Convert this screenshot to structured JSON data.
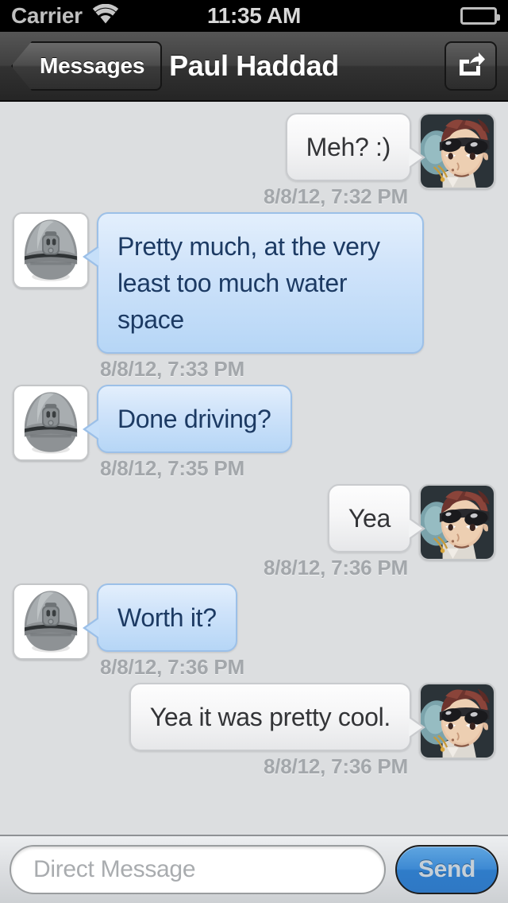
{
  "status_bar": {
    "carrier": "Carrier",
    "wifi_icon": "wifi-icon",
    "time": "11:35 AM",
    "battery_icon": "battery-full-icon"
  },
  "nav_bar": {
    "back_label": "Messages",
    "title": "Paul Haddad",
    "share_icon": "share-export-icon"
  },
  "conversation": {
    "messages": [
      {
        "direction": "outgoing",
        "text": "Meh? :)",
        "timestamp": "8/8/12, 7:32 PM",
        "avatar": "anime-goggles-avatar"
      },
      {
        "direction": "incoming",
        "text": "Pretty much, at the very least too much water space",
        "timestamp": "8/8/12, 7:33 PM",
        "avatar": "egg-robot-avatar"
      },
      {
        "direction": "incoming",
        "text": "Done driving?",
        "timestamp": "8/8/12, 7:35 PM",
        "avatar": "egg-robot-avatar"
      },
      {
        "direction": "outgoing",
        "text": "Yea",
        "timestamp": "8/8/12, 7:36 PM",
        "avatar": "anime-goggles-avatar"
      },
      {
        "direction": "incoming",
        "text": "Worth it?",
        "timestamp": "8/8/12, 7:36 PM",
        "avatar": "egg-robot-avatar"
      },
      {
        "direction": "outgoing",
        "text": "Yea it was pretty cool.",
        "timestamp": "8/8/12, 7:36 PM",
        "avatar": "anime-goggles-avatar"
      }
    ]
  },
  "toolbar": {
    "input_placeholder": "Direct Message",
    "input_value": "",
    "send_label": "Send"
  },
  "colors": {
    "background": "#dcdee0",
    "incoming_bubble": "#cfe3fa",
    "incoming_text": "#1c3a63",
    "outgoing_bubble": "#f2f3f4",
    "outgoing_text": "#333437",
    "timestamp": "#a3a7ab",
    "send_button": "#3e8ad3",
    "nav_bar": "#3f3f3f"
  }
}
